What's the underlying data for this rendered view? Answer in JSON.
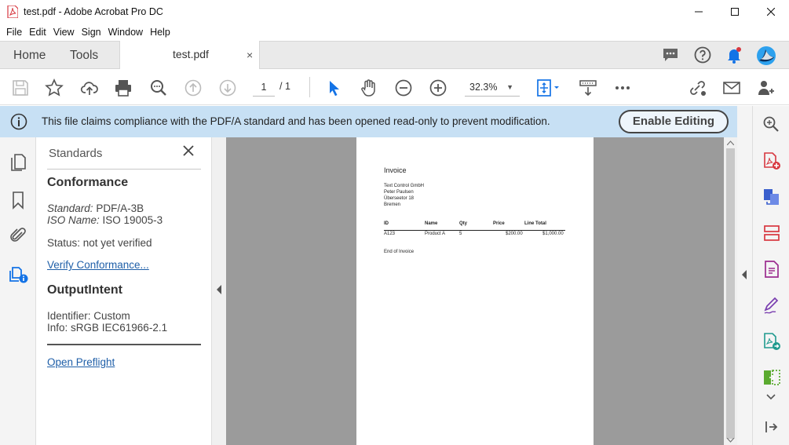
{
  "window": {
    "title": "test.pdf - Adobe Acrobat Pro DC",
    "menu": [
      "File",
      "Edit",
      "View",
      "Sign",
      "Window",
      "Help"
    ]
  },
  "tabs": {
    "home": "Home",
    "tools": "Tools",
    "document": "test.pdf",
    "close": "×"
  },
  "toolbar": {
    "current_page": "1",
    "page_total": "/ 1",
    "zoom": "32.3%"
  },
  "infobar": {
    "message": "This file claims compliance with the PDF/A standard and has been opened read-only to prevent modification.",
    "button": "Enable Editing"
  },
  "panel": {
    "title": "Standards",
    "conformance_heading": "Conformance",
    "standard_label": "Standard:",
    "standard_value": "PDF/A-3B",
    "iso_label": "ISO Name:",
    "iso_value": "ISO 19005-3",
    "status": "Status: not yet verified",
    "verify_link": "Verify Conformance...",
    "output_heading": "OutputIntent",
    "identifier": "Identifier: Custom",
    "info": "Info: sRGB IEC61966-2.1",
    "preflight_link": "Open Preflight"
  },
  "document": {
    "title": "Invoice",
    "address": [
      "Text Control GmbH",
      "Peter Paulsen",
      "Überseetor 18",
      "Bremen"
    ],
    "columns": [
      "ID",
      "Name",
      "Qty",
      "Price",
      "Line Total"
    ],
    "row": [
      "A123",
      "Product A",
      "5",
      "$200.00",
      "$1,000.00"
    ],
    "footer": "End of Invoice"
  },
  "colors": {
    "accent_blue": "#1473e6",
    "acrobat_red": "#d7373f",
    "info_bg": "#c7e0f4",
    "tool_purple": "#9b2d8f"
  }
}
